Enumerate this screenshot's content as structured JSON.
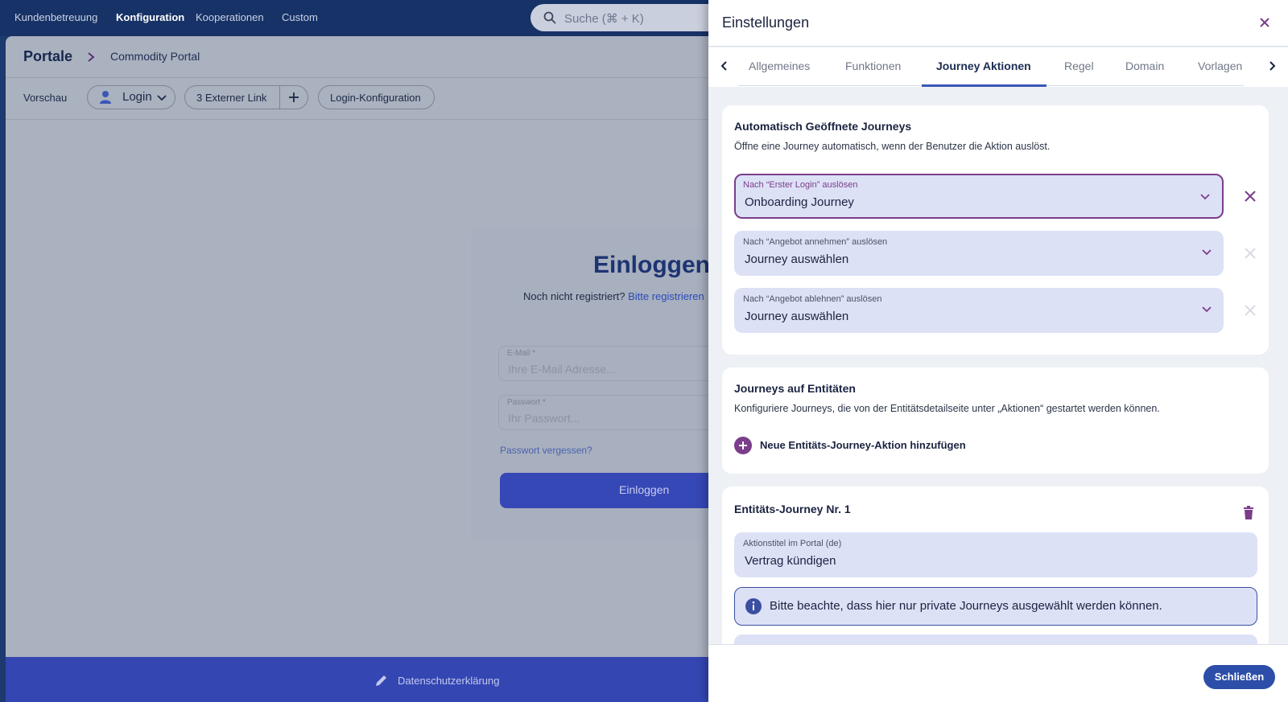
{
  "topnav": {
    "links": [
      "Kundenbetreuung",
      "Konfiguration",
      "Kooperationen",
      "Custom"
    ],
    "active": "Konfiguration",
    "search_placeholder": "Suche (⌘ + K)"
  },
  "breadcrumb": {
    "root": "Portale",
    "current": "Commodity Portal"
  },
  "toolbar": {
    "preview_label": "Vorschau",
    "login_select": "Login",
    "external_link": "3 Externer Link",
    "login_config": "Login-Konfiguration"
  },
  "login_preview": {
    "title": "Einloggen",
    "not_registered": "Noch nicht registriert?",
    "register_link": "Bitte registrieren",
    "email_label": "E-Mail *",
    "email_placeholder": "Ihre E-Mail Adresse...",
    "password_label": "Passwort *",
    "password_placeholder": "Ihr Passwort...",
    "forgot": "Passwort vergessen?",
    "button": "Einloggen"
  },
  "footer": {
    "privacy": "Datenschutzerklärung"
  },
  "panel": {
    "title": "Einstellungen",
    "tabs": [
      "Allgemeines",
      "Funktionen",
      "Journey Aktionen",
      "Regel",
      "Domain",
      "Vorlagen"
    ],
    "active_tab": "Journey Aktionen",
    "auto_section": {
      "title": "Automatisch Geöffnete Journeys",
      "desc": "Öffne eine Journey automatisch, wenn der Benutzer die Aktion auslöst.",
      "selects": [
        {
          "label": "Nach “Erster Login” auslösen",
          "value": "Onboarding Journey"
        },
        {
          "label": "Nach “Angebot annehmen” auslösen",
          "value": "Journey auswählen"
        },
        {
          "label": "Nach “Angebot ablehnen” auslösen",
          "value": "Journey auswählen"
        }
      ]
    },
    "entity_section": {
      "title": "Journeys auf Entitäten",
      "desc": "Konfiguriere Journeys, die von der Entitätsdetailseite unter „Aktionen“ gestartet werden können.",
      "add_label": "Neue Entitäts-Journey-Aktion hinzufügen"
    },
    "entity_journey": {
      "title": "Entitäts-Journey Nr. 1",
      "action_label": "Aktionstitel im Portal (de)",
      "action_value": "Vertrag kündigen",
      "info": "Bitte beachte, dass hier nur private Journeys ausgewählt werden können."
    },
    "close_button": "Schließen"
  }
}
